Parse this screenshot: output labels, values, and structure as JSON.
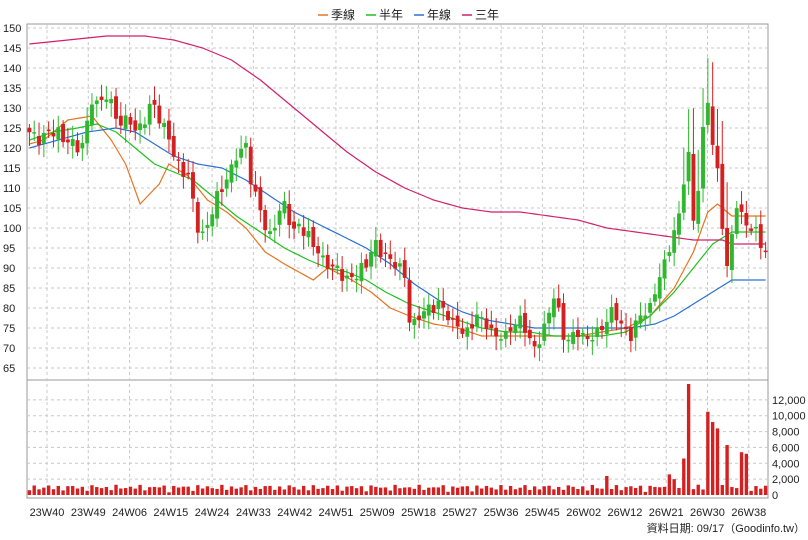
{
  "chart_data": {
    "type": "candlestick",
    "legend": [
      {
        "label": "季線",
        "color": "#e6731f"
      },
      {
        "label": "半年",
        "color": "#20c020"
      },
      {
        "label": "年線",
        "color": "#2a6fd6"
      },
      {
        "label": "三年",
        "color": "#d0206a"
      }
    ],
    "price_axis": {
      "ticks": [
        65,
        70,
        75,
        80,
        85,
        90,
        95,
        100,
        105,
        110,
        115,
        120,
        125,
        130,
        135,
        140,
        145,
        150
      ],
      "min": 62,
      "max": 151
    },
    "volume_axis": {
      "ticks": [
        0,
        2000,
        4000,
        6000,
        8000,
        10000,
        12000
      ],
      "tick_labels": [
        "0",
        "2,000",
        "4,000",
        "6,000",
        "8,000",
        "10,000",
        "12,000"
      ],
      "max": 14000
    },
    "x_labels": [
      "23W40",
      "23W49",
      "24W06",
      "24W15",
      "24W24",
      "24W33",
      "24W42",
      "24W51",
      "25W09",
      "25W18",
      "25W27",
      "25W36",
      "25W45",
      "26W02",
      "26W12",
      "26W21",
      "26W30",
      "26W38"
    ],
    "up_color": "#2fb82f",
    "down_color": "#d42020",
    "volume_color": "#d42020",
    "footer": "資料日期: 09/17（Goodinfo.tw）",
    "ma_anchors": {
      "season": [
        [
          0,
          121
        ],
        [
          3,
          122
        ],
        [
          8,
          127
        ],
        [
          13,
          128
        ],
        [
          17,
          122
        ],
        [
          20,
          116
        ],
        [
          23,
          106
        ],
        [
          27,
          111
        ],
        [
          29,
          116
        ],
        [
          33,
          113
        ],
        [
          37,
          107
        ],
        [
          41,
          104
        ],
        [
          45,
          100
        ],
        [
          49,
          94
        ],
        [
          53,
          91
        ],
        [
          56,
          89
        ],
        [
          59,
          87
        ],
        [
          62,
          90
        ],
        [
          67,
          87
        ],
        [
          71,
          84
        ],
        [
          75,
          80
        ],
        [
          79,
          78
        ],
        [
          84,
          76
        ],
        [
          89,
          75
        ],
        [
          94,
          73
        ],
        [
          99,
          73
        ],
        [
          104,
          73
        ],
        [
          109,
          73
        ],
        [
          114,
          73
        ],
        [
          119,
          74
        ],
        [
          124,
          75
        ],
        [
          129,
          78
        ],
        [
          134,
          85
        ],
        [
          138,
          94
        ],
        [
          141,
          104
        ],
        [
          143,
          106
        ],
        [
          146,
          103
        ]
      ],
      "half": [
        [
          0,
          122
        ],
        [
          5,
          124
        ],
        [
          10,
          125
        ],
        [
          14,
          126
        ],
        [
          18,
          124
        ],
        [
          22,
          120
        ],
        [
          26,
          116
        ],
        [
          30,
          114
        ],
        [
          34,
          112
        ],
        [
          38,
          108
        ],
        [
          43,
          103
        ],
        [
          48,
          99
        ],
        [
          53,
          95
        ],
        [
          58,
          92
        ],
        [
          62,
          90
        ],
        [
          66,
          89
        ],
        [
          70,
          87
        ],
        [
          74,
          84
        ],
        [
          79,
          81
        ],
        [
          84,
          79
        ],
        [
          89,
          77
        ],
        [
          94,
          75
        ],
        [
          99,
          74
        ],
        [
          104,
          74
        ],
        [
          109,
          73
        ],
        [
          114,
          73
        ],
        [
          119,
          73
        ],
        [
          124,
          74
        ],
        [
          129,
          78
        ],
        [
          134,
          84
        ],
        [
          138,
          90
        ],
        [
          142,
          96
        ],
        [
          146,
          99
        ]
      ],
      "annual": [
        [
          0,
          120
        ],
        [
          6,
          122
        ],
        [
          12,
          124
        ],
        [
          18,
          125
        ],
        [
          22,
          124
        ],
        [
          26,
          121
        ],
        [
          30,
          118
        ],
        [
          35,
          116
        ],
        [
          40,
          115
        ],
        [
          45,
          112
        ],
        [
          50,
          108
        ],
        [
          55,
          104
        ],
        [
          60,
          101
        ],
        [
          65,
          98
        ],
        [
          70,
          95
        ],
        [
          75,
          91
        ],
        [
          80,
          86
        ],
        [
          85,
          82
        ],
        [
          90,
          79
        ],
        [
          95,
          77
        ],
        [
          100,
          76
        ],
        [
          105,
          75
        ],
        [
          110,
          75
        ],
        [
          115,
          75
        ],
        [
          120,
          75
        ],
        [
          125,
          75
        ],
        [
          130,
          76
        ],
        [
          134,
          78
        ],
        [
          138,
          81
        ],
        [
          142,
          84
        ],
        [
          146,
          87
        ]
      ],
      "three": [
        [
          0,
          146
        ],
        [
          8,
          147
        ],
        [
          16,
          148
        ],
        [
          24,
          148
        ],
        [
          30,
          147
        ],
        [
          36,
          145
        ],
        [
          42,
          142
        ],
        [
          48,
          137
        ],
        [
          54,
          131
        ],
        [
          60,
          125
        ],
        [
          66,
          119
        ],
        [
          72,
          114
        ],
        [
          78,
          110
        ],
        [
          84,
          107
        ],
        [
          90,
          105
        ],
        [
          96,
          104
        ],
        [
          102,
          104
        ],
        [
          108,
          103
        ],
        [
          114,
          102
        ],
        [
          120,
          100
        ],
        [
          126,
          99
        ],
        [
          132,
          98
        ],
        [
          138,
          97
        ],
        [
          144,
          97
        ],
        [
          146,
          96
        ]
      ]
    },
    "price_anchors": [
      [
        0,
        124
      ],
      [
        2,
        122
      ],
      [
        4,
        124
      ],
      [
        6,
        124
      ],
      [
        7,
        122
      ],
      [
        8,
        122
      ],
      [
        10,
        120
      ],
      [
        11,
        121
      ],
      [
        12,
        126
      ],
      [
        13,
        132
      ],
      [
        14,
        131
      ],
      [
        15,
        132
      ],
      [
        16,
        133
      ],
      [
        17,
        131
      ],
      [
        18,
        128
      ],
      [
        19,
        126
      ],
      [
        20,
        127
      ],
      [
        21,
        127
      ],
      [
        22,
        124
      ],
      [
        24,
        127
      ],
      [
        25,
        130
      ],
      [
        26,
        131
      ],
      [
        27,
        127
      ],
      [
        28,
        125
      ],
      [
        29,
        123
      ],
      [
        30,
        118
      ],
      [
        31,
        116
      ],
      [
        32,
        114
      ],
      [
        33,
        113
      ],
      [
        34,
        107
      ],
      [
        35,
        100
      ],
      [
        36,
        98
      ],
      [
        37,
        101
      ],
      [
        38,
        104
      ],
      [
        39,
        108
      ],
      [
        40,
        110
      ],
      [
        41,
        112
      ],
      [
        42,
        115
      ],
      [
        43,
        118
      ],
      [
        44,
        119
      ],
      [
        45,
        121
      ],
      [
        46,
        112
      ],
      [
        47,
        108
      ],
      [
        48,
        105
      ],
      [
        49,
        100
      ],
      [
        50,
        98
      ],
      [
        51,
        101
      ],
      [
        52,
        104
      ],
      [
        53,
        106
      ],
      [
        54,
        102
      ],
      [
        55,
        99
      ],
      [
        56,
        101
      ],
      [
        57,
        99
      ],
      [
        58,
        98
      ],
      [
        59,
        96
      ],
      [
        60,
        94
      ],
      [
        61,
        92
      ],
      [
        62,
        91
      ],
      [
        63,
        90
      ],
      [
        64,
        90
      ],
      [
        65,
        88
      ],
      [
        66,
        87
      ],
      [
        67,
        88
      ],
      [
        68,
        88
      ],
      [
        69,
        90
      ],
      [
        70,
        91
      ],
      [
        71,
        94
      ],
      [
        72,
        96
      ],
      [
        73,
        94
      ],
      [
        74,
        93
      ],
      [
        75,
        92
      ],
      [
        76,
        91
      ],
      [
        77,
        90
      ],
      [
        78,
        88
      ],
      [
        79,
        77
      ],
      [
        80,
        76
      ],
      [
        81,
        78
      ],
      [
        82,
        79
      ],
      [
        83,
        80
      ],
      [
        84,
        80
      ],
      [
        85,
        81
      ],
      [
        86,
        80
      ],
      [
        87,
        78
      ],
      [
        88,
        76
      ],
      [
        89,
        76
      ],
      [
        90,
        74
      ],
      [
        91,
        74
      ],
      [
        92,
        76
      ],
      [
        93,
        78
      ],
      [
        94,
        77
      ],
      [
        95,
        76
      ],
      [
        96,
        74
      ],
      [
        97,
        73
      ],
      [
        98,
        73
      ],
      [
        99,
        73
      ],
      [
        100,
        75
      ],
      [
        101,
        76
      ],
      [
        102,
        77
      ],
      [
        103,
        75
      ],
      [
        104,
        72
      ],
      [
        105,
        70
      ],
      [
        106,
        72
      ],
      [
        107,
        75
      ],
      [
        108,
        79
      ],
      [
        109,
        83
      ],
      [
        110,
        79
      ],
      [
        111,
        73
      ],
      [
        112,
        72
      ],
      [
        113,
        73
      ],
      [
        114,
        74
      ],
      [
        115,
        73
      ],
      [
        116,
        72
      ],
      [
        117,
        73
      ],
      [
        118,
        74
      ],
      [
        119,
        75
      ],
      [
        120,
        77
      ],
      [
        121,
        79
      ],
      [
        122,
        78
      ],
      [
        123,
        76
      ],
      [
        124,
        74
      ],
      [
        125,
        73
      ],
      [
        126,
        76
      ],
      [
        127,
        78
      ],
      [
        128,
        79
      ],
      [
        129,
        80
      ],
      [
        130,
        84
      ],
      [
        131,
        88
      ],
      [
        132,
        91
      ],
      [
        133,
        95
      ],
      [
        134,
        99
      ],
      [
        135,
        103
      ],
      [
        136,
        112
      ],
      [
        137,
        118
      ],
      [
        138,
        102
      ],
      [
        139,
        110
      ],
      [
        140,
        124
      ],
      [
        141,
        132
      ],
      [
        142,
        121
      ],
      [
        143,
        114
      ],
      [
        144,
        101
      ],
      [
        145,
        90
      ],
      [
        146,
        98
      ],
      [
        147,
        106
      ],
      [
        148,
        103
      ],
      [
        149,
        101
      ],
      [
        150,
        100
      ],
      [
        151,
        99
      ],
      [
        152,
        96
      ],
      [
        153,
        94
      ]
    ],
    "volume_spikes": {
      "137": 14000,
      "141": 10500,
      "142": 9200,
      "143": 8400,
      "145": 6300,
      "148": 5400,
      "149": 5200,
      "120": 2400,
      "133": 2600,
      "136": 4600,
      "134": 2000
    },
    "n_candles": 154
  }
}
